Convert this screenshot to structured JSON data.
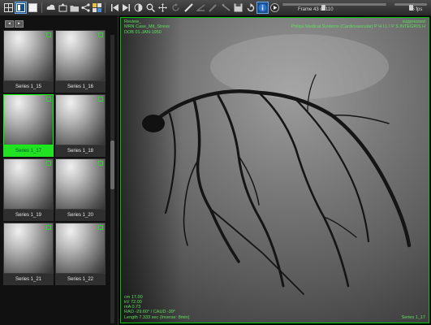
{
  "toolbar": {
    "icons": [
      "grid-view-icon",
      "single-view-icon",
      "white-screen-icon",
      "cloud-icon",
      "export-icon",
      "folder-icon",
      "share-icon",
      "layout-icon",
      "first-frame-icon",
      "last-frame-icon",
      "contrast-icon",
      "zoom-icon",
      "pan-icon",
      "rotate-icon",
      "ruler-icon",
      "angle-icon",
      "pen-icon",
      "calibrate-icon",
      "save-icon",
      "reset-icon",
      "info-icon",
      "play-icon"
    ],
    "frame_label": "Frame 43 of 110",
    "fps_label": "15 fps",
    "frame_progress": 0.39,
    "fps_level": 0.5
  },
  "series": [
    {
      "label": "Series 1_15"
    },
    {
      "label": "Series 1_16"
    },
    {
      "label": "Series 1_17",
      "selected": true
    },
    {
      "label": "Series 1_18"
    },
    {
      "label": "Series 1_19"
    },
    {
      "label": "Series 1_20"
    },
    {
      "label": "Series 1_21"
    },
    {
      "label": "Series 1_22"
    }
  ],
  "viewer": {
    "top_left": [
      "Review_",
      "MRN Case_Mit_Stress",
      "DOB 01-JAN-1950"
    ],
    "top_right": [
      "suppressed",
      "Philips Medical Systems (Cardiovascular) P H I L I P S INTEGRIS H",
      ""
    ],
    "bottom_left": [
      "cm 17.00",
      "kV 72.00",
      "mA 0.73",
      "RAO -29.60° / CAUD -39°",
      "Length 7.333 sec (Inverse: 8min)"
    ],
    "bottom_right": "Series 1_17"
  },
  "colors": {
    "overlay": "#5be05b",
    "selection": "#22e022",
    "toolbar_active": "#1b4f8c"
  }
}
